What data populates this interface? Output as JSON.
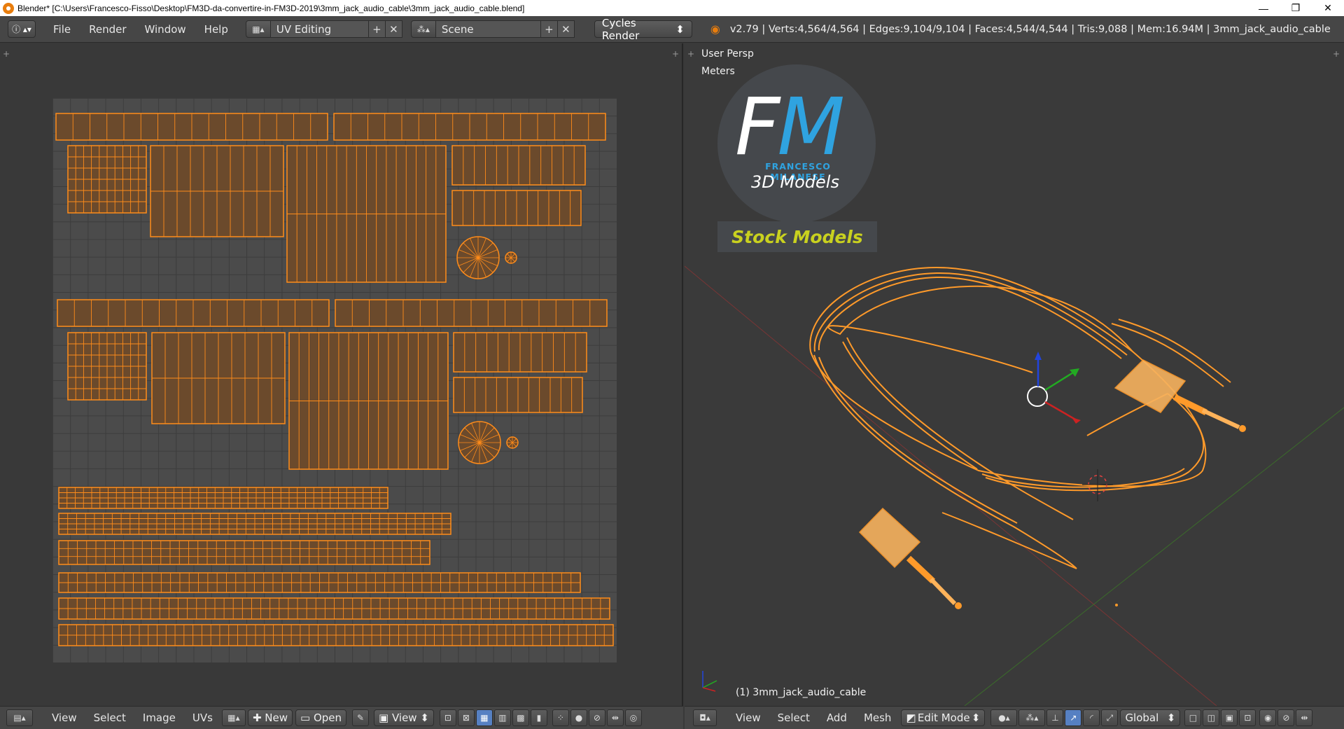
{
  "window": {
    "title": "Blender* [C:\\Users\\Francesco-Fisso\\Desktop\\FM3D-da-convertire-in-FM3D-2019\\3mm_jack_audio_cable\\3mm_jack_audio_cable.blend]",
    "minimize": "—",
    "maximize": "❐",
    "close": "✕"
  },
  "header": {
    "info_icon": "ⓘ ▴▾",
    "menus": [
      "File",
      "Render",
      "Window",
      "Help"
    ],
    "screen_layout": "UV Editing",
    "scene": "Scene",
    "render_engine": "Cycles Render",
    "stats": "v2.79 | Verts:4,564/4,564 | Edges:9,104/9,104 | Faces:4,544/4,544 | Tris:9,088 | Mem:16.94M | 3mm_jack_audio_cable",
    "plus": "+",
    "x": "✕"
  },
  "viewport": {
    "view_name": "User Persp",
    "units": "Meters",
    "object_label": "(1) 3mm_jack_audio_cable"
  },
  "logo": {
    "f": "F",
    "m": "M",
    "name": "FRANCESCO MILANESE",
    "subtitle": "3D Models",
    "stock": "Stock Models"
  },
  "uv_footer": {
    "menus": [
      "View",
      "Select",
      "Image",
      "UVs"
    ],
    "new_label": "New",
    "open_label": "Open",
    "view_label": "View"
  },
  "view_footer": {
    "menus": [
      "View",
      "Select",
      "Add",
      "Mesh"
    ],
    "mode": "Edit Mode",
    "orientation": "Global"
  },
  "colors": {
    "accent": "#ff8c1a",
    "uv_fill": "#6b4a2c",
    "logo_blue": "#2fa3e0",
    "stock_yellow": "#c9d11f"
  }
}
